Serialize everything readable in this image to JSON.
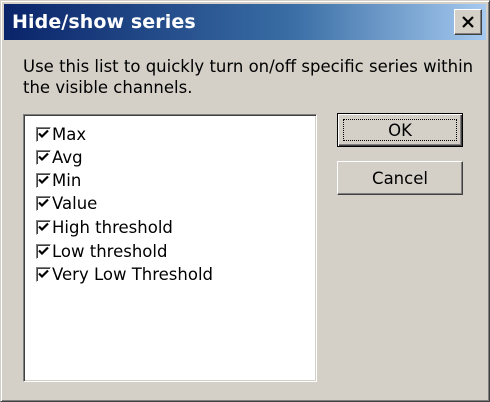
{
  "dialog": {
    "title": "Hide/show series",
    "instructions": "Use this list to quickly turn on/off specific series within the visible channels.",
    "close_icon": "close-x-icon"
  },
  "series_list": {
    "items": [
      {
        "label": "Max",
        "checked": true
      },
      {
        "label": "Avg",
        "checked": true
      },
      {
        "label": "Min",
        "checked": true
      },
      {
        "label": "Value",
        "checked": true
      },
      {
        "label": "High threshold",
        "checked": true
      },
      {
        "label": "Low threshold",
        "checked": true
      },
      {
        "label": "Very Low Threshold",
        "checked": true
      }
    ]
  },
  "buttons": {
    "ok_label": "OK",
    "cancel_label": "Cancel"
  },
  "colors": {
    "title_active_start": "#0a246a",
    "title_active_end": "#a6caf0",
    "dialog_face": "#d4d0c8"
  }
}
